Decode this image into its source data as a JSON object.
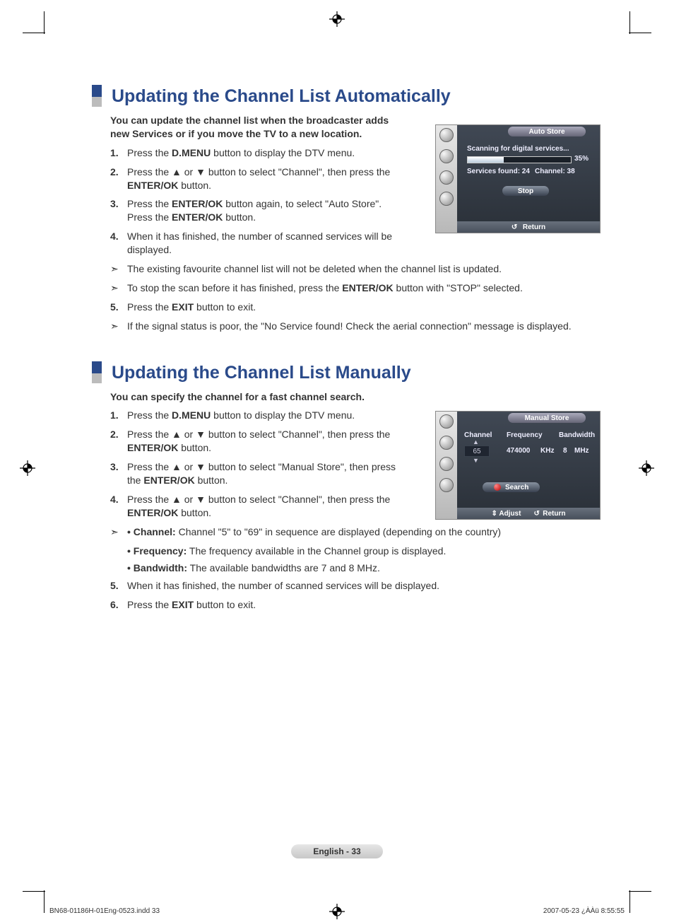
{
  "kw": {
    "dmenu": "D.MENU",
    "enterok": "ENTER/OK",
    "exit": "EXIT"
  },
  "sections": [
    {
      "title": "Updating the Channel List Automatically",
      "intro": "You can update the channel list when the broadcaster adds new Services or if you move the TV to a new location.",
      "steps": [
        {
          "num": "1."
        },
        {
          "num": "2."
        },
        {
          "num": "3."
        },
        {
          "num": "4.",
          "text": "When it has finished, the number of scanned services will be displayed."
        },
        {
          "num": "5."
        }
      ],
      "notes": [
        "The existing favourite channel list will not be deleted when the channel list is updated.",
        "If the signal status is poor, the \"No Service found! Check the aerial connection\" message is displayed."
      ]
    },
    {
      "title": "Updating the Channel List Manually",
      "intro": "You can specify the channel for a fast channel search.",
      "steps": [
        {
          "num": "1."
        },
        {
          "num": "2."
        },
        {
          "num": "3."
        },
        {
          "num": "4."
        },
        {
          "num": "5.",
          "text": "When it has finished, the number of scanned services will be displayed."
        },
        {
          "num": "6."
        }
      ],
      "bullets": [
        {
          "label": "Channel:",
          "text": "Channel \"5\" to \"69\" in sequence are displayed (depending on the country)"
        },
        {
          "label": "Frequency:",
          "text": "The frequency available in the Channel group is displayed."
        },
        {
          "label": "Bandwidth:",
          "text": "The available bandwidths are 7 and 8 MHz."
        }
      ]
    }
  ],
  "osd1": {
    "tab": "Auto Store",
    "scanning": "Scanning for digital services...",
    "percent": "35%",
    "services": "Services found: 24",
    "channel": "Channel: 38",
    "stop": "Stop",
    "return": "Return"
  },
  "osd2": {
    "tab": "Manual Store",
    "cols": [
      "Channel",
      "Frequency",
      "Bandwidth"
    ],
    "channel": "65",
    "frequency": "474000",
    "freq_unit": "KHz",
    "bandwidth": "8",
    "bw_unit": "MHz",
    "search": "Search",
    "adjust": "Adjust",
    "return": "Return"
  },
  "page": {
    "label": "English - 33"
  },
  "footer": {
    "left": "BN68-01186H-01Eng-0523.indd   33",
    "right": "2007-05-23   ¿ÀÀü 8:55:55"
  }
}
